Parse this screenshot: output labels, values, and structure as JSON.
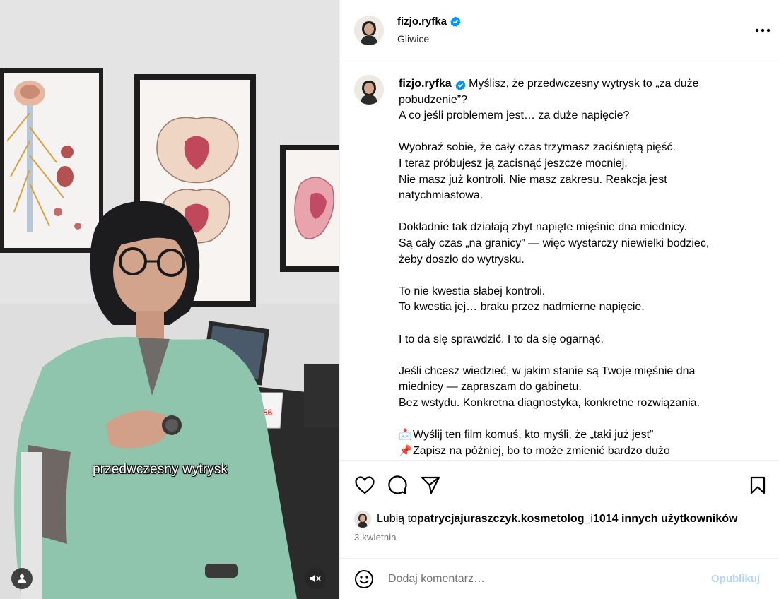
{
  "media": {
    "caption_overlay": "przedwczesny wytrysk",
    "tags_icon": "user-tag-icon",
    "mute_icon": "muted-speaker-icon"
  },
  "header": {
    "username": "fizjo.ryfka",
    "location": "Gliwice",
    "verified_icon": "verified-badge-icon",
    "more_icon": "more-options-icon"
  },
  "caption": {
    "username": "fizjo.ryfka",
    "first_line": "Myślisz, że przedwczesny wytrysk to „za duże pobudzenie”?",
    "lines": [
      "A co jeśli problemem jest… za duże napięcie?",
      "",
      "Wyobraź sobie, że cały czas trzymasz zaciśniętą pięść.",
      "I teraz próbujesz ją zacisnąć jeszcze mocniej.",
      "Nie masz już kontroli. Nie masz zakresu. Reakcja jest natychmiastowa.",
      "",
      "Dokładnie tak działają zbyt napięte mięśnie dna miednicy.",
      "Są cały czas „na granicy” — więc wystarczy niewielki bodziec, żeby doszło do wytrysku.",
      "",
      "To nie kwestia słabej kontroli.",
      "To kwestia jej… braku przez nadmierne napięcie.",
      "",
      "I to da się sprawdzić. I to da się ogarnąć.",
      "",
      "Jeśli chcesz wiedzieć, w jakim stanie są Twoje mięśnie dna miednicy — zapraszam do gabinetu.",
      "Bez wstydu. Konkretna diagnostyka, konkretne rozwiązania.",
      ""
    ],
    "bullets": [
      {
        "emoji": "📩",
        "text": "Wyślij ten film komuś, kto myśli, że „taki już jest”"
      },
      {
        "emoji": "📌",
        "text": "Zapisz na później, bo to może zmienić bardzo dużo"
      }
    ]
  },
  "actions": {
    "like_icon": "heart-icon",
    "comment_icon": "comment-bubble-icon",
    "share_icon": "share-paper-plane-icon",
    "save_icon": "bookmark-icon"
  },
  "likes": {
    "prefix": "Lubią to ",
    "user": "patrycjajuraszczyk.kosmetolog_",
    "middle": " i ",
    "others": "1014 innych użytkowników"
  },
  "date": "3 kwietnia",
  "comment": {
    "emoji_icon": "smiley-emoji-icon",
    "placeholder": "Dodaj komentarz…",
    "publish_label": "Opublikuj",
    "publish_color": "#b3d4f8"
  },
  "colors": {
    "verified": "#0095f6",
    "scrubs": "#8fc4ad",
    "muted_text": "#737373"
  }
}
